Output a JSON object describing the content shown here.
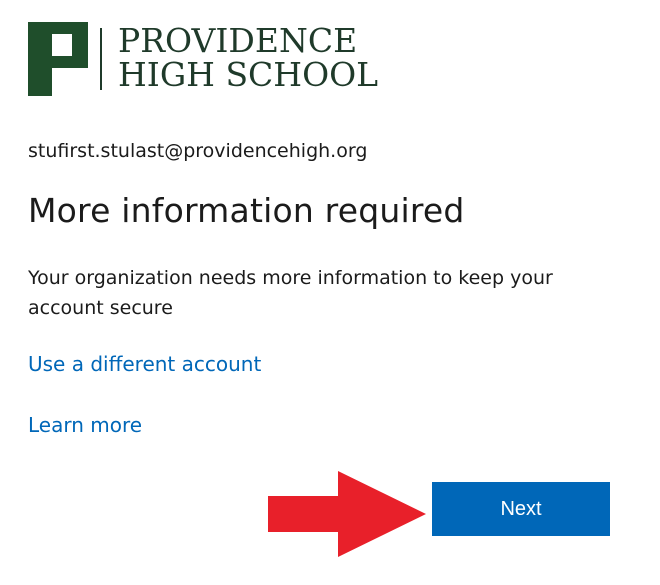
{
  "logo": {
    "line1": "PROVIDENCE",
    "line2": "HIGH SCHOOL",
    "color": "#1f3a2a"
  },
  "account": {
    "email": "stufirst.stulast@providencehigh.org"
  },
  "heading": {
    "title": "More information required"
  },
  "body": {
    "description": "Your organization needs more information to keep your account secure"
  },
  "links": {
    "different_account": "Use a different account",
    "learn_more": "Learn more"
  },
  "actions": {
    "next_label": "Next"
  },
  "colors": {
    "accent": "#0067b8",
    "arrow": "#e8202a"
  },
  "icons": {
    "logo_mark": "providence-p-logo-icon",
    "annotation": "red-arrow-icon"
  }
}
